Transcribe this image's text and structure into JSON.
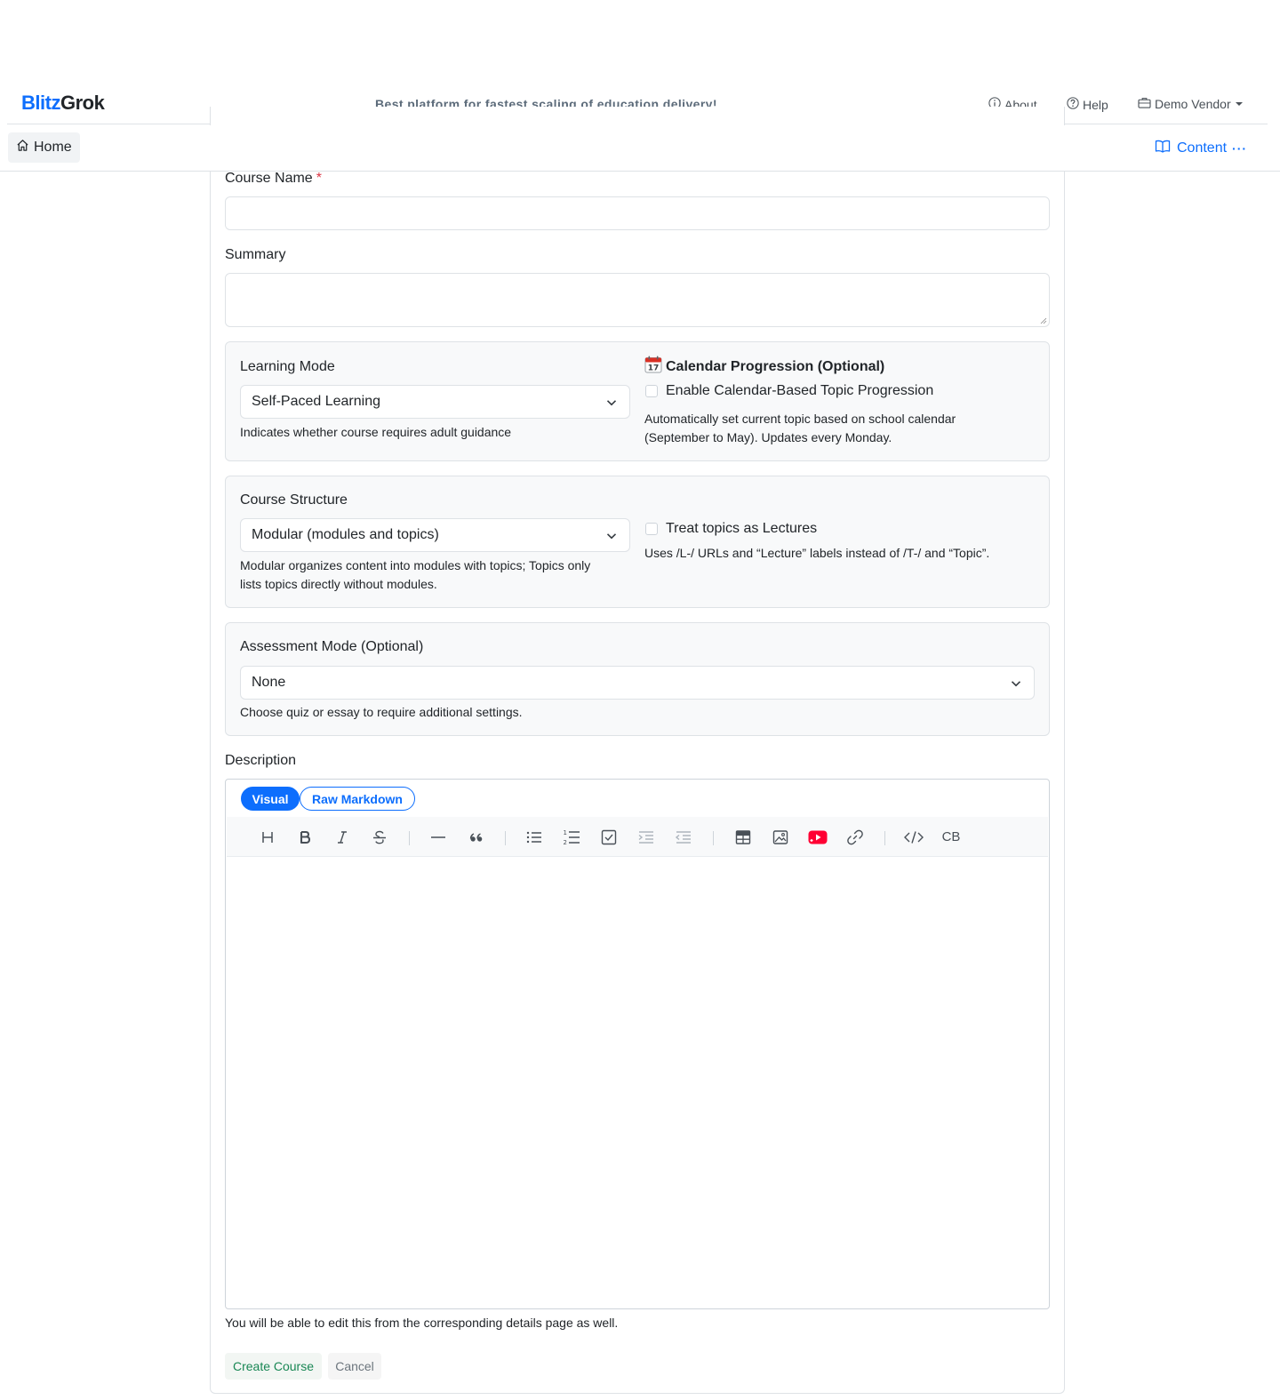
{
  "header": {
    "brand_part1": "Blitz",
    "brand_part2": "Grok",
    "tagline": "Best platform for fastest scaling of education delivery!",
    "nav": {
      "about": "About",
      "help": "Help",
      "vendor": "Demo Vendor"
    }
  },
  "subnav": {
    "home": "Home",
    "content": "Content",
    "more": "···"
  },
  "form": {
    "course_name": {
      "label": "Course Name",
      "required_mark": "*",
      "value": ""
    },
    "summary": {
      "label": "Summary",
      "value": ""
    },
    "learning_mode": {
      "label": "Learning Mode",
      "selected": "Self-Paced Learning",
      "help": "Indicates whether course requires adult guidance"
    },
    "calendar": {
      "title": "Calendar Progression (Optional)",
      "checkbox_label": "Enable Calendar-Based Topic Progression",
      "checked": false,
      "help_line1": "Automatically set current topic based on school calendar",
      "help_line2": "(September to May). Updates every Monday."
    },
    "course_structure": {
      "label": "Course Structure",
      "selected": "Modular (modules and topics)",
      "help_line1": "Modular organizes content into modules with topics; Topics only",
      "help_line2": "lists topics directly without modules."
    },
    "lectures": {
      "checkbox_label": "Treat topics as Lectures",
      "checked": false,
      "help": "Uses /L-/ URLs and “Lecture” labels instead of /T-/ and “Topic”."
    },
    "assessment": {
      "label": "Assessment Mode (Optional)",
      "selected": "None",
      "help": "Choose quiz or essay to require additional settings."
    },
    "description": {
      "label": "Description",
      "tab_visual": "Visual",
      "tab_raw": "Raw Markdown",
      "content": "",
      "toolbar_icons": [
        "heading-icon",
        "bold-icon",
        "italic-icon",
        "strikethrough-icon",
        "horizontal-rule-icon",
        "quote-icon",
        "bullet-list-icon",
        "numbered-list-icon",
        "task-list-icon",
        "indent-icon",
        "outdent-icon",
        "table-icon",
        "image-icon",
        "youtube-icon",
        "link-icon",
        "code-icon",
        "code-block-icon"
      ],
      "code_block_text": "CB",
      "footnote": "You will be able to edit this from the corresponding details page as well."
    },
    "buttons": {
      "create": "Create Course",
      "cancel": "Cancel"
    }
  },
  "colors": {
    "primary": "#0d6efd",
    "danger": "#dc3545",
    "success": "#198754",
    "youtube": "#ff0033",
    "panel_bg": "#f8f9fa",
    "border": "#dee2e6"
  }
}
